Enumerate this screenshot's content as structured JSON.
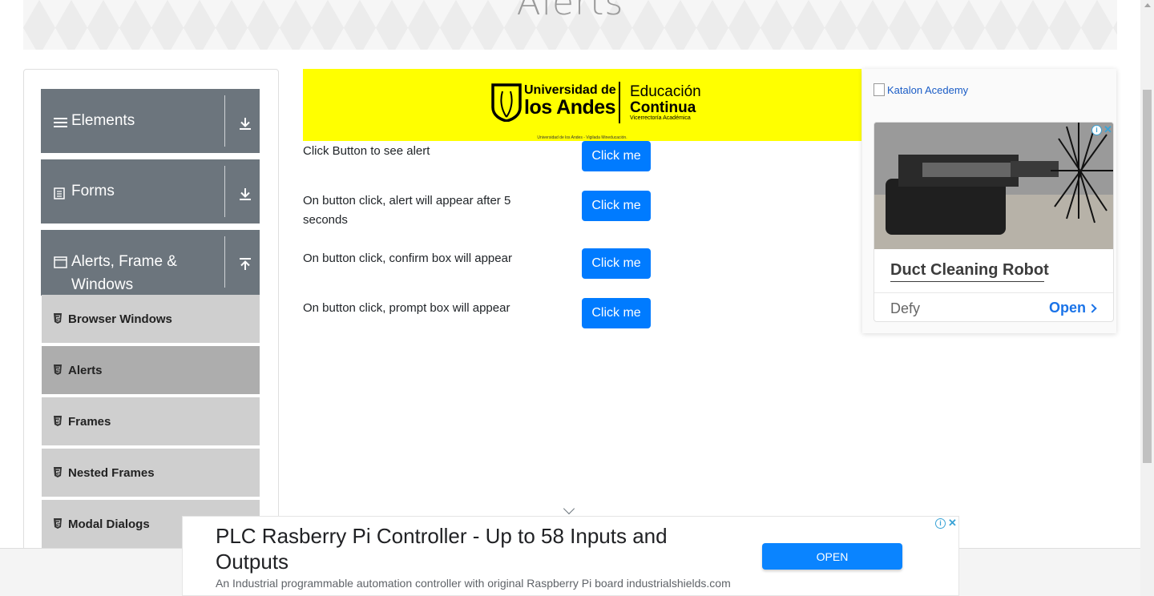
{
  "header": {
    "title": "Alerts"
  },
  "sidebar": {
    "groups": [
      {
        "label": "Elements",
        "expanded": false
      },
      {
        "label": "Forms",
        "expanded": false
      },
      {
        "label": "Alerts, Frame & Windows",
        "expanded": true
      }
    ],
    "items": [
      {
        "label": "Browser Windows",
        "active": false
      },
      {
        "label": "Alerts",
        "active": true
      },
      {
        "label": "Frames",
        "active": false
      },
      {
        "label": "Nested Frames",
        "active": false
      },
      {
        "label": "Modal Dialogs",
        "active": false
      }
    ]
  },
  "banner": {
    "logo_left_top": "Universidad de",
    "logo_left_bottom": "los Andes",
    "logo_right_top": "Educación",
    "logo_right_mid": "Continua",
    "logo_right_bottom": "Vicerrectoría Académica",
    "small_text": "Universidad de los Andes - Vigilada Mineducación.",
    "bg_color": "#ffff00"
  },
  "rows": [
    {
      "text": "Click Button to see alert",
      "button": "Click me"
    },
    {
      "text": "On button click, alert will appear after 5 seconds",
      "button": "Click me"
    },
    {
      "text": "On button click, confirm box will appear",
      "button": "Click me"
    },
    {
      "text": "On button click, prompt box will appear",
      "button": "Click me"
    }
  ],
  "ad_right": {
    "link_text": "Katalon Acedemy",
    "title": "Duct Cleaning Robot",
    "source": "Defy",
    "cta": "Open"
  },
  "bottom_ad": {
    "title": "PLC Rasberry Pi Controller - Up to 58 Inputs and Outputs",
    "description": "An Industrial programmable automation controller with original Raspberry Pi board industrialshields.com",
    "button": "OPEN"
  },
  "colors": {
    "primary": "#007bff",
    "sidebar_header": "#6c757d",
    "menu_item": "#cfcfcf",
    "menu_item_active": "#adadad"
  }
}
